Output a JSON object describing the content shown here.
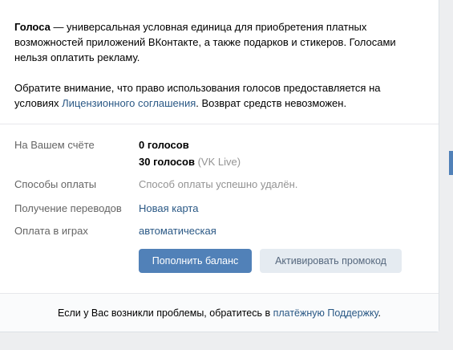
{
  "intro": {
    "term": "Голоса",
    "definition": " — универсальная условная единица для приобретения платных возможностей приложений ВКонтакте, а также подарков и стикеров. Голосами нельзя оплатить рекламу.",
    "notice_before": "Обратите внимание, что право использования голосов предоставляется на условиях ",
    "notice_link": "Лицензионного соглашения",
    "notice_after": ". Возврат средств невозможен."
  },
  "account": {
    "balance_label": "На Вашем счёте",
    "balance_main": "0 голосов",
    "balance_secondary": "30 голосов",
    "balance_secondary_note": "(VK Live)",
    "payment_methods_label": "Способы оплаты",
    "payment_methods_value": "Способ оплаты успешно удалён.",
    "transfers_label": "Получение переводов",
    "transfers_value": "Новая карта",
    "games_label": "Оплата в играх",
    "games_value": "автоматическая"
  },
  "buttons": {
    "top_up": "Пополнить баланс",
    "promo": "Активировать промокод"
  },
  "footer": {
    "before": "Если у Вас возникли проблемы, обратитесь в ",
    "link": "платёжную Поддержку",
    "after": "."
  },
  "colors": {
    "accent": "#5181b8",
    "link": "#2a5885",
    "muted": "#939393"
  }
}
